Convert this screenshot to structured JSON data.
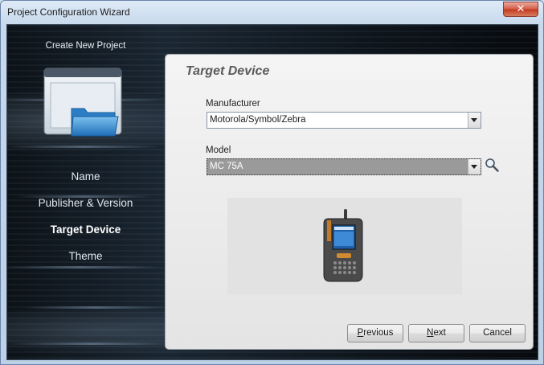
{
  "window": {
    "title": "Project Configuration Wizard",
    "close_glyph": "✕"
  },
  "sidebar": {
    "heading": "Create New Project",
    "icon": "folder-window-icon",
    "items": [
      {
        "label": "Name",
        "active": false
      },
      {
        "label": "Publisher & Version",
        "active": false
      },
      {
        "label": "Target Device",
        "active": true
      },
      {
        "label": "Theme",
        "active": false
      }
    ]
  },
  "panel": {
    "title": "Target Device",
    "manufacturer": {
      "label": "Manufacturer",
      "value": "Motorola/Symbol/Zebra"
    },
    "model": {
      "label": "Model",
      "value": "MC 75A"
    },
    "device_image": "handheld-device-image"
  },
  "buttons": {
    "previous": {
      "first": "P",
      "rest": "revious"
    },
    "next": {
      "first": "N",
      "rest": "ext"
    },
    "cancel": "Cancel"
  },
  "colors": {
    "panel_bg": "#e8e8e8",
    "sidebar_bg": "#0d141b",
    "selected_field": "#9a9a9a"
  }
}
